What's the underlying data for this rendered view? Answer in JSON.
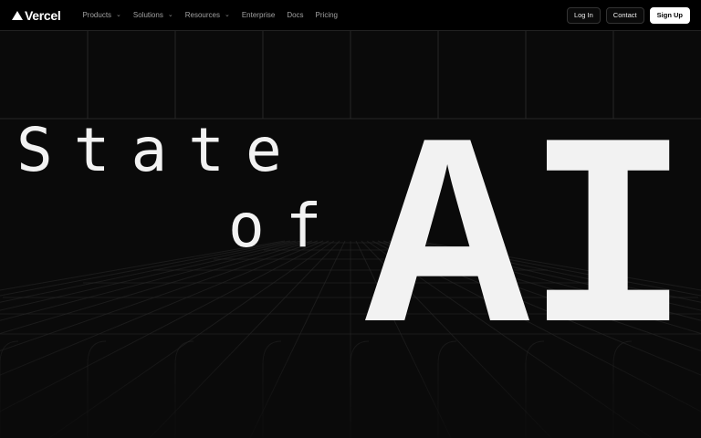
{
  "nav": {
    "brand": "Vercel",
    "menu": [
      {
        "label": "Products",
        "has_dropdown": true
      },
      {
        "label": "Solutions",
        "has_dropdown": true
      },
      {
        "label": "Resources",
        "has_dropdown": true
      },
      {
        "label": "Enterprise",
        "has_dropdown": false
      },
      {
        "label": "Docs",
        "has_dropdown": false
      },
      {
        "label": "Pricing",
        "has_dropdown": false
      }
    ],
    "login_label": "Log In",
    "contact_label": "Contact",
    "signup_label": "Sign Up"
  },
  "hero": {
    "word_state": "State",
    "word_of": "of",
    "word_ai": "AI"
  },
  "colors": {
    "background": "#0a0a0a",
    "nav_background": "#000000",
    "text": "#f2f2f2",
    "grid_line": "#2a2a2a"
  }
}
